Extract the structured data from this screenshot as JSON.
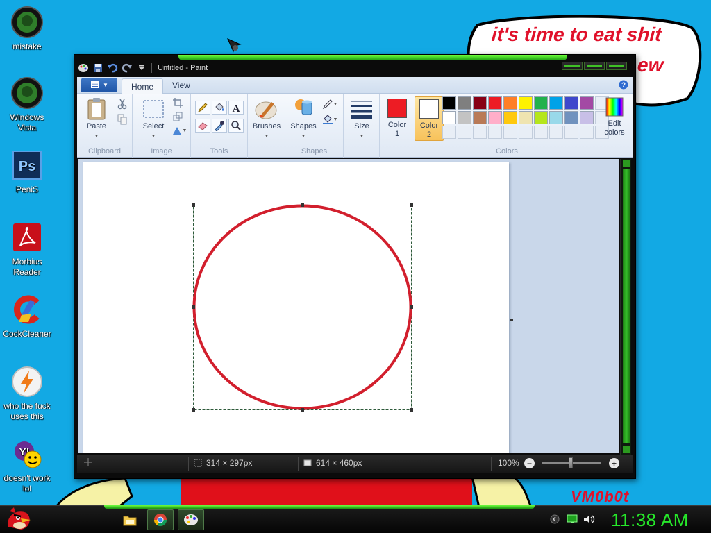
{
  "desktop": {
    "icons": [
      {
        "label_line1": "mistake",
        "label_line2": ""
      },
      {
        "label_line1": "Windows",
        "label_line2": "Vista"
      },
      {
        "label_line1": "PeniS",
        "label_line2": ""
      },
      {
        "label_line1": "Morbius",
        "label_line2": "Reader"
      },
      {
        "label_line1": "CockCleaner",
        "label_line2": ""
      },
      {
        "label_line1": "who the fuck",
        "label_line2": "uses this"
      },
      {
        "label_line1": "doesn't work",
        "label_line2": "lol"
      }
    ],
    "speech_bubble_line1": "it's time to eat shit",
    "speech_bubble_line2": "ew",
    "watermark": "VM0b0t"
  },
  "paint": {
    "title": "Untitled - Paint",
    "tabs": [
      "Home",
      "View"
    ],
    "active_tab": "Home",
    "groups": {
      "clipboard": {
        "label": "Clipboard",
        "paste": "Paste"
      },
      "image": {
        "label": "Image",
        "select": "Select"
      },
      "tools": {
        "label": "Tools"
      },
      "brushes": {
        "label": "Brushes"
      },
      "shapes": {
        "label": "Shapes",
        "button": "Shapes"
      },
      "size": {
        "label": "Size"
      },
      "colors": {
        "label": "Colors",
        "color1_line1": "Color",
        "color1_line2": "1",
        "color2_line1": "Color",
        "color2_line2": "2",
        "edit_line1": "Edit",
        "edit_line2": "colors",
        "color1_value": "#ed1c24",
        "color2_value": "#ffffff",
        "palette_row1": [
          "#000000",
          "#7f7f7f",
          "#880015",
          "#ed1c24",
          "#ff7f27",
          "#fff200",
          "#22b14c",
          "#00a2e8",
          "#3f48cc",
          "#a349a4"
        ],
        "palette_row2": [
          "#ffffff",
          "#c3c3c3",
          "#b97a57",
          "#ffaec9",
          "#ffc90e",
          "#efe4b0",
          "#b5e61d",
          "#99d9ea",
          "#7092be",
          "#c8bfe7"
        ]
      }
    },
    "status": {
      "selection_size": "314 × 297px",
      "canvas_size": "614 × 460px",
      "zoom": "100%"
    },
    "shape_stroke_color": "#d21f2d"
  },
  "taskbar": {
    "clock": "11:38 AM"
  }
}
